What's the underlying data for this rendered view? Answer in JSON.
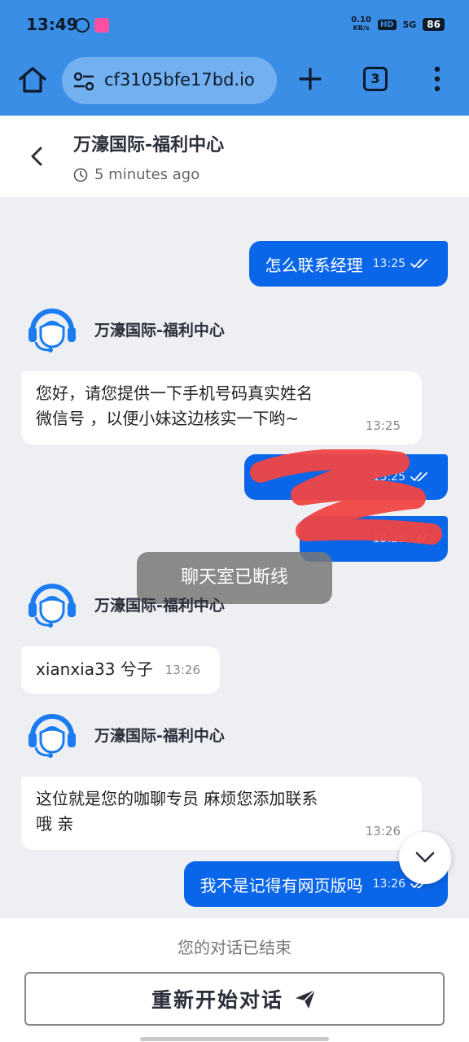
{
  "status_bar": {
    "time": "13:49",
    "network_speed_value": "0.10",
    "network_speed_unit": "KB/s",
    "hd_label": "HD",
    "signal_label": "5G",
    "battery": "86"
  },
  "browser": {
    "url": "cf3105bfe17bd.io",
    "tab_count": "3"
  },
  "chat_header": {
    "title": "万濠国际-福利中心",
    "subtitle": "5 minutes ago"
  },
  "messages": {
    "m1": {
      "text": "怎么联系经理",
      "time": "13:25"
    },
    "agent_name": "万濠国际-福利中心",
    "m2": {
      "line1": "您好，请您提供一下手机号码真实姓名",
      "line2": "微信号 ，以便小妹这边核实一下哟~",
      "time": "13:25"
    },
    "m3": {
      "time": "13:25"
    },
    "m4": {
      "time": "13:25"
    },
    "m5": {
      "text": "xianxia33 兮子",
      "time": "13:26"
    },
    "m6": {
      "line1": "这位就是您的咖聊专员 麻烦您添加联系",
      "line2": "哦 亲",
      "time": "13:26"
    },
    "m7": {
      "text": "我不是记得有网页版吗",
      "time": "13:26"
    }
  },
  "toast": "聊天室已断线",
  "footer": {
    "ended_text": "您的对话已结束",
    "restart_label": "重新开始对话"
  },
  "colors": {
    "browser_bar": "#3a8ee6",
    "outgoing_bubble": "#0a66e8",
    "background": "#eeeff3",
    "redaction": "#f04545"
  }
}
